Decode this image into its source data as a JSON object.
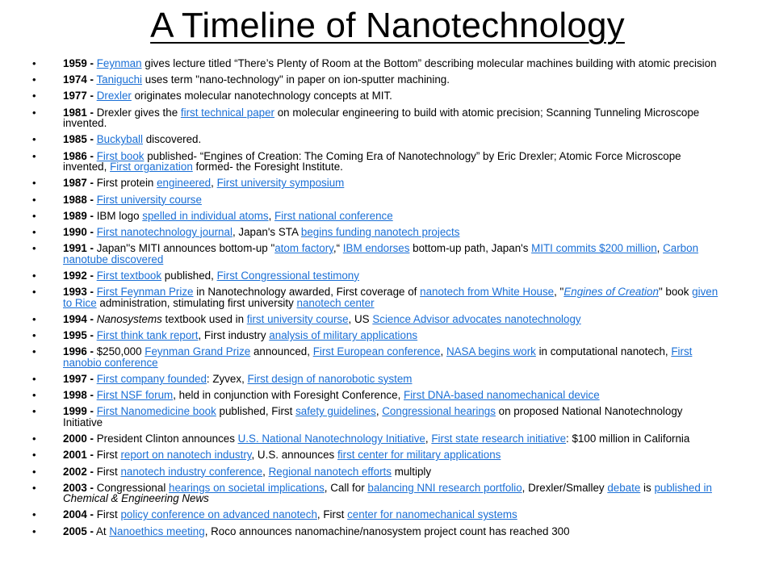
{
  "slide": {
    "title": "A Timeline of Nanotechnology"
  },
  "colors": {
    "link": "#1a6fd6",
    "text": "#000000",
    "background": "#ffffff"
  },
  "entries": [
    {
      "year": "1959 -",
      "parts": [
        {
          "t": "link",
          "v": "Feynman"
        },
        {
          "t": "text",
          "v": " gives lecture titled “There’s Plenty of Room at the Bottom” describing molecular machines building with atomic precision"
        }
      ]
    },
    {
      "year": "1974 -",
      "parts": [
        {
          "t": "link",
          "v": "Taniguchi"
        },
        {
          "t": "text",
          "v": " uses term \"nano-technology\" in paper on ion-sputter machining."
        }
      ]
    },
    {
      "year": "1977 -",
      "parts": [
        {
          "t": "link",
          "v": "Drexler"
        },
        {
          "t": "text",
          "v": " originates molecular nanotechnology concepts at MIT."
        }
      ]
    },
    {
      "year": "1981 -",
      "parts": [
        {
          "t": "text",
          "v": " Drexler gives the "
        },
        {
          "t": "link",
          "v": "first technical paper"
        },
        {
          "t": "text",
          "v": " on molecular engineering to build with atomic precision; Scanning Tunneling Microscope invented."
        }
      ]
    },
    {
      "year": "1985 -",
      "parts": [
        {
          "t": "link",
          "v": "Buckyball"
        },
        {
          "t": "text",
          "v": " discovered."
        }
      ]
    },
    {
      "year": "1986 -",
      "parts": [
        {
          "t": "link",
          "v": "First book"
        },
        {
          "t": "text",
          "v": " published- “Engines of Creation: The Coming Era of Nanotechnology” by Eric Drexler; Atomic Force Microscope invented, "
        },
        {
          "t": "link",
          "v": "First organization"
        },
        {
          "t": "text",
          "v": " formed- the Foresight Institute."
        }
      ]
    },
    {
      "year": "1987 -",
      "parts": [
        {
          "t": "text",
          "v": " First protein  "
        },
        {
          "t": "link",
          "v": "engineered"
        },
        {
          "t": "text",
          "v": ", "
        },
        {
          "t": "link",
          "v": "First university symposium"
        }
      ]
    },
    {
      "year": "1988 -",
      "parts": [
        {
          "t": "link",
          "v": "First university course"
        }
      ]
    },
    {
      "year": "1989 -",
      "parts": [
        {
          "t": "text",
          "v": " IBM logo "
        },
        {
          "t": "link",
          "v": "spelled in individual atoms"
        },
        {
          "t": "text",
          "v": ", "
        },
        {
          "t": "link",
          "v": "First national conference"
        }
      ]
    },
    {
      "year": "1990 -",
      "parts": [
        {
          "t": "link",
          "v": "First nanotechnology journal"
        },
        {
          "t": "text",
          "v": ", Japan's STA "
        },
        {
          "t": "link",
          "v": "begins funding nanotech projects"
        }
      ]
    },
    {
      "year": "1991 -",
      "parts": [
        {
          "t": "text",
          "v": " Japan''s MITI announces bottom-up \""
        },
        {
          "t": "link",
          "v": "atom factory"
        },
        {
          "t": "text",
          "v": ",“ "
        },
        {
          "t": "link",
          "v": "IBM endorses"
        },
        {
          "t": "text",
          "v": " bottom-up path, Japan's "
        },
        {
          "t": "link",
          "v": "MITI commits $200 million"
        },
        {
          "t": "text",
          "v": ", "
        },
        {
          "t": "link",
          "v": "Carbon nanotube discovered"
        }
      ]
    },
    {
      "year": "1992 -",
      "parts": [
        {
          "t": "link",
          "v": "First textbook"
        },
        {
          "t": "text",
          "v": " published, "
        },
        {
          "t": "link",
          "v": "First Congressional testimony"
        }
      ]
    },
    {
      "year": "1993 -",
      "parts": [
        {
          "t": "link",
          "v": "First Feynman Prize"
        },
        {
          "t": "text",
          "v": " in Nanotechnology awarded, First coverage of "
        },
        {
          "t": "link",
          "v": "nanotech from White House"
        },
        {
          "t": "text",
          "v": ", \""
        },
        {
          "t": "linkital",
          "v": "Engines of Creation"
        },
        {
          "t": "text",
          "v": "\" book "
        },
        {
          "t": "link",
          "v": "given to Rice"
        },
        {
          "t": "text",
          "v": " administration, stimulating first university "
        },
        {
          "t": "link",
          "v": "nanotech center"
        }
      ]
    },
    {
      "year": "1994 -",
      "parts": [
        {
          "t": "ital",
          "v": " Nanosystems"
        },
        {
          "t": "text",
          "v": " textbook used in "
        },
        {
          "t": "link",
          "v": "first university course"
        },
        {
          "t": "text",
          "v": ", US "
        },
        {
          "t": "link",
          "v": "Science Advisor advocates nanotechnology"
        }
      ]
    },
    {
      "year": "1995 -",
      "parts": [
        {
          "t": "link",
          "v": "First think tank report"
        },
        {
          "t": "text",
          "v": ",  First industry "
        },
        {
          "t": "link",
          "v": "analysis of military applications"
        }
      ]
    },
    {
      "year": "1996 -",
      "parts": [
        {
          "t": "text",
          "v": " $250,000 "
        },
        {
          "t": "link",
          "v": "Feynman Grand Prize"
        },
        {
          "t": "text",
          "v": " announced, "
        },
        {
          "t": "link",
          "v": "First European conference"
        },
        {
          "t": "text",
          "v": ", "
        },
        {
          "t": "link",
          "v": "NASA begins work"
        },
        {
          "t": "text",
          "v": " in computational nanotech, "
        },
        {
          "t": "link",
          "v": "First nanobio conference"
        }
      ]
    },
    {
      "year": "1997 -",
      "parts": [
        {
          "t": "link",
          "v": "First company founded"
        },
        {
          "t": "text",
          "v": ": Zyvex, "
        },
        {
          "t": "link",
          "v": "First design of nanorobotic system"
        }
      ]
    },
    {
      "year": "1998 -",
      "parts": [
        {
          "t": "link",
          "v": "First NSF forum"
        },
        {
          "t": "text",
          "v": ", held in conjunction with Foresight Conference, "
        },
        {
          "t": "link",
          "v": "First DNA-based nanomechanical device"
        }
      ]
    },
    {
      "year": "1999 -",
      "parts": [
        {
          "t": "link",
          "v": "First Nanomedicine book"
        },
        {
          "t": "text",
          "v": " published, First "
        },
        {
          "t": "link",
          "v": "safety guidelines"
        },
        {
          "t": "text",
          "v": ", "
        },
        {
          "t": "link",
          "v": "Congressional hearings"
        },
        {
          "t": "text",
          "v": " on proposed National Nanotechnology Initiative"
        }
      ]
    },
    {
      "year": "2000 -",
      "parts": [
        {
          "t": "text",
          "v": " President Clinton announces "
        },
        {
          "t": "link",
          "v": "U.S. National Nanotechnology Initiative"
        },
        {
          "t": "text",
          "v": ", "
        },
        {
          "t": "link",
          "v": "First state research initiative"
        },
        {
          "t": "text",
          "v": ": $100 million in California"
        }
      ]
    },
    {
      "year": "2001 -",
      "parts": [
        {
          "t": "text",
          "v": " First "
        },
        {
          "t": "link",
          "v": "report on nanotech industry"
        },
        {
          "t": "text",
          "v": ", U.S. announces "
        },
        {
          "t": "link",
          "v": "first center for military applications"
        }
      ]
    },
    {
      "year": "2002 -",
      "parts": [
        {
          "t": "text",
          "v": " First "
        },
        {
          "t": "link",
          "v": "nanotech industry conference"
        },
        {
          "t": "text",
          "v": ", "
        },
        {
          "t": "link",
          "v": "Regional nanotech efforts"
        },
        {
          "t": "text",
          "v": " multiply"
        }
      ]
    },
    {
      "year": "2003 -",
      "parts": [
        {
          "t": "text",
          "v": " Congressional "
        },
        {
          "t": "link",
          "v": "hearings on societal implications"
        },
        {
          "t": "text",
          "v": ", Call for "
        },
        {
          "t": "link",
          "v": "balancing NNI research portfolio"
        },
        {
          "t": "text",
          "v": ", Drexler/Smalley "
        },
        {
          "t": "link",
          "v": "debate"
        },
        {
          "t": "text",
          "v": " is "
        },
        {
          "t": "link",
          "v": "published in"
        },
        {
          "t": "ital",
          "v": " Chemical & Engineering News"
        }
      ]
    },
    {
      "year": "2004 -",
      "parts": [
        {
          "t": "text",
          "v": " First "
        },
        {
          "t": "link",
          "v": "policy conference on advanced nanotech"
        },
        {
          "t": "text",
          "v": ", First "
        },
        {
          "t": "link",
          "v": "center for nanomechanical systems"
        }
      ]
    },
    {
      "year": "2005 -",
      "parts": [
        {
          "t": "text",
          "v": " At "
        },
        {
          "t": "link",
          "v": "Nanoethics meeting"
        },
        {
          "t": "text",
          "v": ", Roco announces nanomachine/nanosystem project count has reached 300"
        }
      ]
    }
  ]
}
